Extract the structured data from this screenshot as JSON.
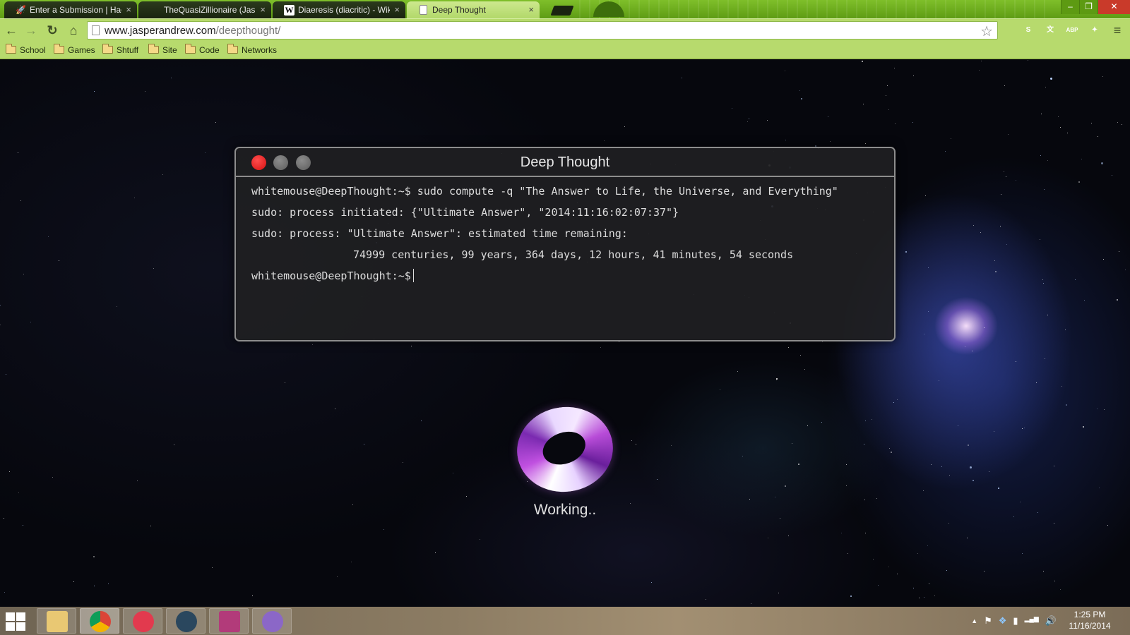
{
  "browser": {
    "tabs": [
      {
        "title": "Enter a Submission | Hack",
        "favicon": "rocket-icon",
        "active": false
      },
      {
        "title": "TheQuasiZillionaire (Jaspe",
        "favicon": "reddit-icon",
        "active": false
      },
      {
        "title": "Diaeresis (diacritic) - Wiki",
        "favicon": "wikipedia-icon",
        "active": false
      },
      {
        "title": "Deep Thought",
        "favicon": "page-icon",
        "active": true
      }
    ],
    "tab_close_glyph": "×",
    "window_controls": {
      "minimize": "–",
      "maximize": "❐",
      "close": "✕"
    },
    "address": {
      "domain": "www.jasperandrew.com",
      "path": "/deepthought/"
    },
    "nav": {
      "back": "←",
      "forward": "→",
      "reload": "↻",
      "home": "⌂",
      "star": "☆",
      "menu": "≡"
    },
    "extensions": [
      {
        "name": "s-extension-icon",
        "label": "S",
        "color": "#1c1c1c"
      },
      {
        "name": "translate-extension-icon",
        "label": "文",
        "color": "#3b78e7"
      },
      {
        "name": "adblock-plus-icon",
        "label": "ABP",
        "color": "#d8262c"
      },
      {
        "name": "puzzle-extension-icon",
        "label": "✦",
        "color": "#3a3a3a"
      }
    ],
    "bookmarks": [
      "School",
      "Games",
      "Shtuff",
      "Site",
      "Code",
      "Networks"
    ]
  },
  "terminal": {
    "title": "Deep Thought",
    "lines": [
      "whitemouse@DeepThought:~$ sudo compute -q \"The Answer to Life, the Universe, and Everything\"",
      "sudo: process initiated: {\"Ultimate Answer\", \"2014:11:16:02:07:37\"}",
      "sudo: process: \"Ultimate Answer\": estimated time remaining:",
      "74999 centuries, 99 years, 364 days, 12 hours, 41 minutes, 54 seconds"
    ],
    "prompt": "whitemouse@DeepThought:~$"
  },
  "status": {
    "working_text": "Working.."
  },
  "taskbar": {
    "apps": [
      {
        "name": "file-explorer",
        "color": "#e9c873"
      },
      {
        "name": "chrome",
        "color": "#db4437"
      },
      {
        "name": "itunes",
        "color": "#e23a4e"
      },
      {
        "name": "steam",
        "color": "#2a475e"
      },
      {
        "name": "game-app",
        "color": "#b23b7a"
      },
      {
        "name": "github",
        "color": "#8b67c7"
      }
    ],
    "tray": {
      "show_hidden": "▲",
      "flag": "⚑",
      "dropbox": "❖",
      "power": "▮",
      "network": "▂▄▆",
      "volume": "🔊"
    },
    "clock": {
      "time": "1:25 PM",
      "date": "11/16/2014"
    }
  },
  "colors": {
    "browser_accent": "#b7da6d",
    "terminal_close": "#e21b1b"
  }
}
